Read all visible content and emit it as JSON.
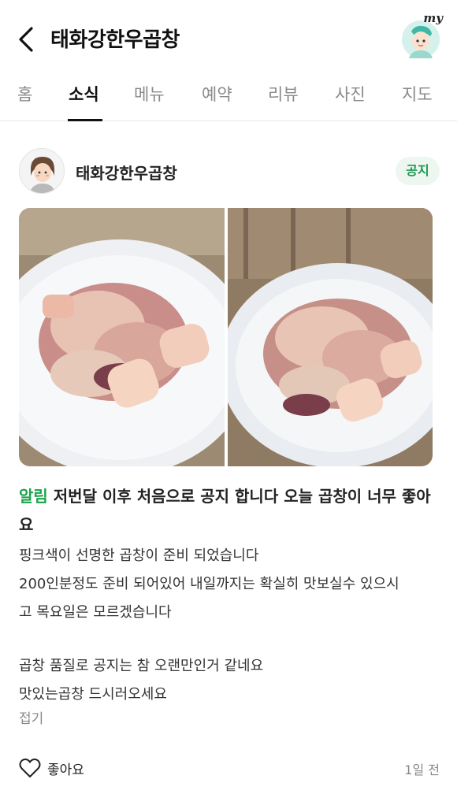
{
  "header": {
    "title": "태화강한우곱창",
    "my_label": "my"
  },
  "tabs": [
    {
      "label": "홈",
      "active": false
    },
    {
      "label": "소식",
      "active": true
    },
    {
      "label": "메뉴",
      "active": false
    },
    {
      "label": "예약",
      "active": false
    },
    {
      "label": "리뷰",
      "active": false
    },
    {
      "label": "사진",
      "active": false
    },
    {
      "label": "지도",
      "active": false
    }
  ],
  "post": {
    "author": "태화강한우곱창",
    "badge": "공지",
    "headline_tag": "알림",
    "headline_text": " 저번달 이후 처음으로 공지 합니다 오늘 곱창이 너무 좋아요",
    "body_lines": [
      "핑크색이 선명한 곱창이 준비 되었습니다",
      "200인분정도 준비 되어있어 내일까지는 확실히 맛보실수 있으시",
      "고 목요일은 모르겠습니다",
      "곱창 품질로 공지는 참 오랜만인거 같네요",
      "맛있는곱창 드시러오세요"
    ],
    "fold_label": "접기",
    "like_label": "좋아요",
    "time_ago": "1일 전"
  },
  "colors": {
    "accent_green": "#1aa34a",
    "badge_bg": "#eef6f0"
  }
}
